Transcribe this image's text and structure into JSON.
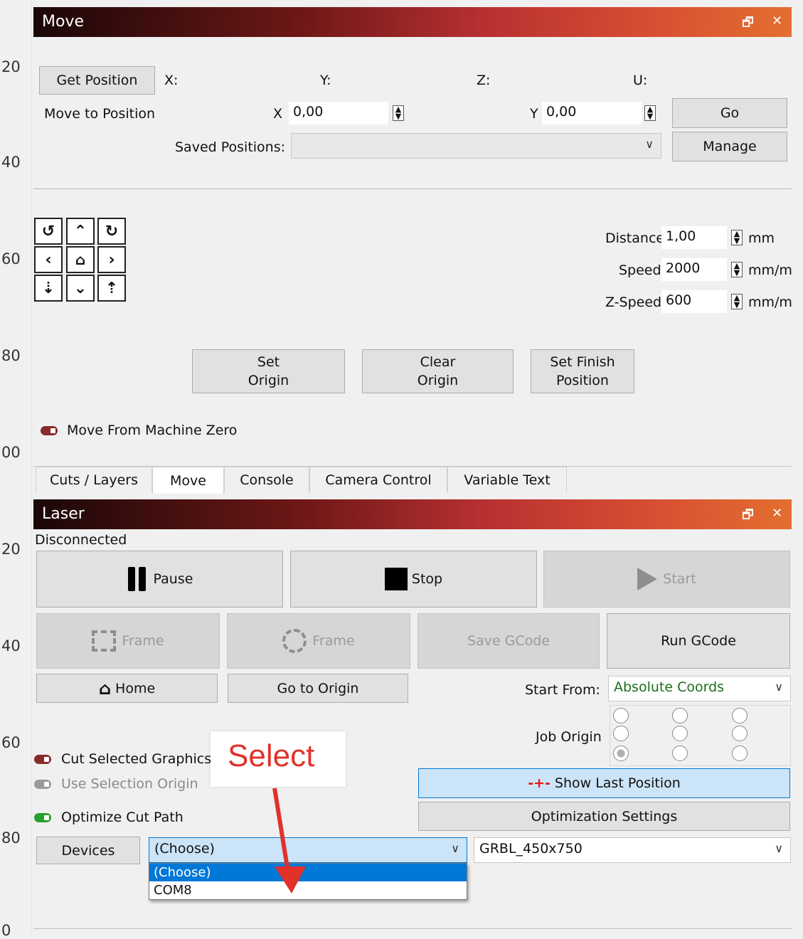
{
  "ruler": [
    "20",
    "40",
    "60",
    "80",
    "00",
    "20",
    "40",
    "60",
    "80",
    "0"
  ],
  "move_panel": {
    "title": "Move",
    "float_icon": "float-window-icon",
    "close_icon": "close-icon",
    "get_position_label": "Get Position",
    "coord_labels": [
      "X:",
      "Y:",
      "Z:",
      "U:"
    ],
    "move_to_label": "Move to Position",
    "x_label": "X",
    "x_value": "0,00",
    "y_label": "Y",
    "y_value": "0,00",
    "go_label": "Go",
    "saved_positions_label": "Saved Positions:",
    "saved_positions_value": "",
    "manage_label": "Manage",
    "distance_label": "Distance",
    "distance_value": "1,00",
    "distance_unit": "mm",
    "speed_label": "Speed",
    "speed_value": "2000",
    "speed_unit": "mm/m",
    "zspeed_label": "Z-Speed",
    "zspeed_value": "600",
    "zspeed_unit": "mm/m",
    "set_origin_label": "Set\nOrigin",
    "clear_origin_label": "Clear\nOrigin",
    "set_finish_label": "Set Finish\nPosition",
    "move_from_zero_label": "Move From Machine Zero"
  },
  "tabs": [
    "Cuts / Layers",
    "Move",
    "Console",
    "Camera Control",
    "Variable Text"
  ],
  "active_tab": "Move",
  "laser_panel": {
    "title": "Laser",
    "status": "Disconnected",
    "pause_label": "Pause",
    "stop_label": "Stop",
    "start_label": "Start",
    "frame_rect_label": "Frame",
    "frame_circle_label": "Frame",
    "save_gcode_label": "Save GCode",
    "run_gcode_label": "Run GCode",
    "home_label": "Home",
    "go_to_origin_label": "Go to Origin",
    "start_from_label": "Start From:",
    "start_from_value": "Absolute Coords",
    "job_origin_label": "Job Origin",
    "cut_selected_label": "Cut Selected Graphics",
    "use_selection_origin_label": "Use Selection Origin",
    "optimize_label": "Optimize Cut Path",
    "show_last_position_label": "Show Last Position",
    "optimization_settings_label": "Optimization Settings",
    "devices_label": "Devices",
    "port_value": "(Choose)",
    "port_options": [
      "(Choose)",
      "COM8"
    ],
    "device_profile_value": "GRBL_450x750"
  },
  "annotation": {
    "callout_text": "Select",
    "arrow_color": "#e0322b"
  },
  "colors": {
    "toggle_on_red": "#8b2a2a",
    "toggle_on_green": "#27a12e",
    "toggle_off": "#9a9a9a",
    "selection_blue": "#0078d7",
    "start_from_text": "#1b6e1b",
    "crosshair_red": "#e11"
  }
}
